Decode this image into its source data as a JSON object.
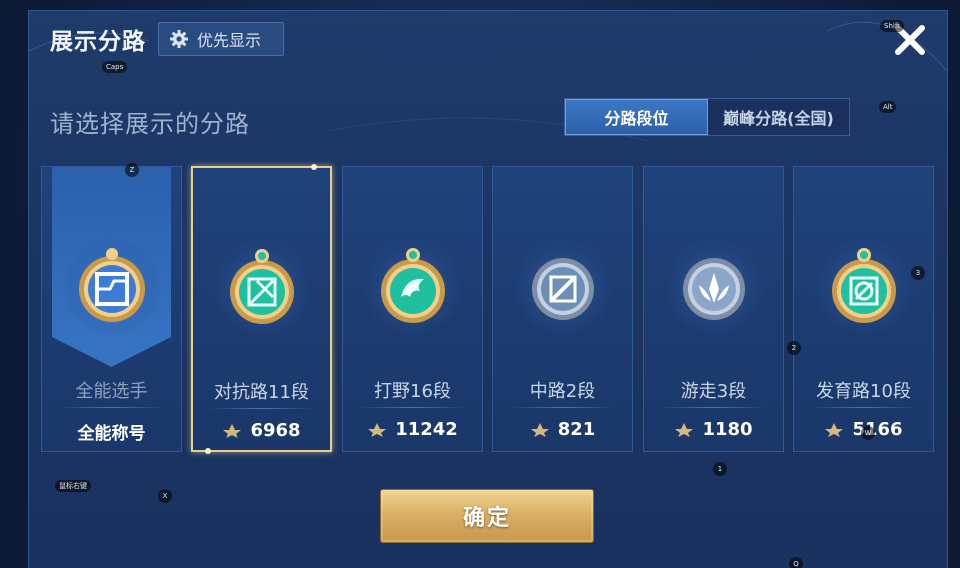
{
  "header": {
    "title": "展示分路",
    "priority_label": "优先显示",
    "close_icon": "close-icon"
  },
  "subtitle": "请选择展示的分路",
  "segment": {
    "options": [
      {
        "label": "分路段位",
        "active": true
      },
      {
        "label": "巅峰分路(全国)",
        "active": false
      }
    ]
  },
  "cards": [
    {
      "name": "全能选手",
      "value": "全能称号",
      "icon": "all-round-emblem-icon",
      "selected": false,
      "colors": {
        "main": "#3d7cd6"
      }
    },
    {
      "name": "对抗路11段",
      "value": "6968",
      "icon": "clash-lane-emblem-icon",
      "selected": true,
      "colors": {
        "main": "#1fbf9f"
      }
    },
    {
      "name": "打野16段",
      "value": "11242",
      "icon": "jungle-emblem-icon",
      "selected": false,
      "colors": {
        "main": "#1fbf9f"
      }
    },
    {
      "name": "中路2段",
      "value": "821",
      "icon": "mid-lane-emblem-icon",
      "selected": false,
      "colors": {
        "main": "#6c8fb8"
      }
    },
    {
      "name": "游走3段",
      "value": "1180",
      "icon": "roam-emblem-icon",
      "selected": false,
      "colors": {
        "main": "#8aa6c8"
      }
    },
    {
      "name": "发育路10段",
      "value": "5166",
      "icon": "farm-lane-emblem-icon",
      "selected": false,
      "colors": {
        "main": "#1fbf9f"
      }
    }
  ],
  "confirm_label": "确定",
  "key_hints": {
    "caps": "Caps",
    "shift": "Shift",
    "alt": "Alt",
    "z": "Z",
    "x": "X",
    "w": "W",
    "q": "Q",
    "k1": "1",
    "k2": "2",
    "k3": "3",
    "right_click": "鼠标右键"
  }
}
